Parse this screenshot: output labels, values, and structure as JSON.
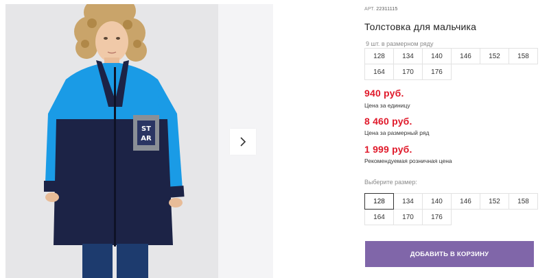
{
  "gallery": {
    "photo_alt": "",
    "patch_text": [
      "ST",
      "AR"
    ],
    "next_icon": "chevron-right-icon"
  },
  "product": {
    "article_label": "АРТ.",
    "article_number": "22311115",
    "title": "Толстовка для мальчика",
    "row_hint": "9 шт. в размерном ряду",
    "row_sizes": [
      "128",
      "134",
      "140",
      "146",
      "152",
      "158",
      "164",
      "170",
      "176"
    ]
  },
  "prices": [
    {
      "value": "940 руб.",
      "label": "Цена за единицу"
    },
    {
      "value": "8 460 руб.",
      "label": "Цена за размерный ряд"
    },
    {
      "value": "1 999 руб.",
      "label": "Рекомендуемая розничная цена"
    }
  ],
  "size_select": {
    "label": "Выберите размер:",
    "sizes": [
      "128",
      "134",
      "140",
      "146",
      "152",
      "158",
      "164",
      "170",
      "176"
    ],
    "selected": "128"
  },
  "cart": {
    "add_label": "ДОБАВИТЬ В КОРЗИНУ"
  },
  "colors": {
    "price": "#e0192a",
    "button": "#8066a9",
    "jacket_blue": "#1a9be6",
    "jacket_navy": "#1c2346"
  }
}
